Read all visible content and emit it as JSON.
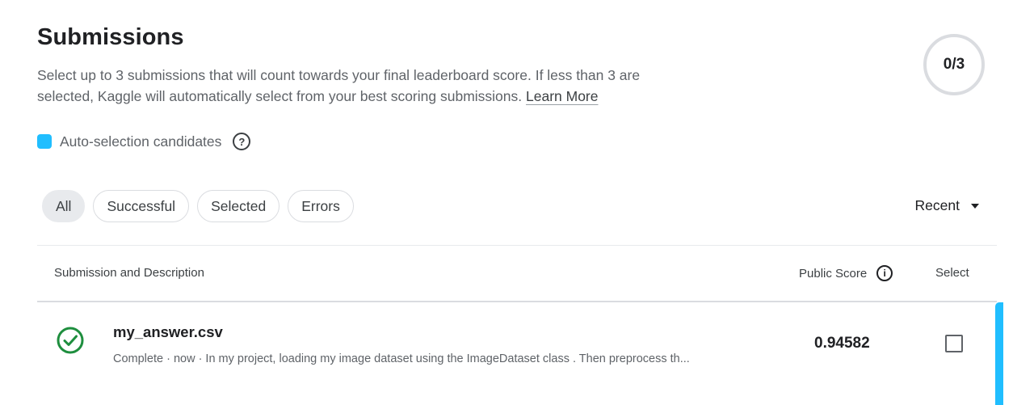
{
  "header": {
    "title": "Submissions",
    "description": "Select up to 3 submissions that will count towards your final leaderboard score. If less than 3 are selected, Kaggle will automatically select from your best scoring submissions.",
    "learn_more": "Learn More",
    "counter": "0/3"
  },
  "legend": {
    "label": "Auto-selection candidates",
    "swatch_color": "#20beff",
    "help_icon": "?"
  },
  "filters": {
    "chips": [
      {
        "label": "All",
        "active": true
      },
      {
        "label": "Successful",
        "active": false
      },
      {
        "label": "Selected",
        "active": false
      },
      {
        "label": "Errors",
        "active": false
      }
    ],
    "sort_label": "Recent"
  },
  "table": {
    "headers": {
      "description": "Submission and Description",
      "score": "Public Score",
      "score_info_icon": "i",
      "select": "Select"
    },
    "rows": [
      {
        "name": "my_answer.csv",
        "meta": "Complete · now · In my project, loading my image dataset using the ImageDataset class . Then preprocess th...",
        "score": "0.94582",
        "status": "success"
      }
    ]
  },
  "colors": {
    "accent": "#20beff",
    "success": "#1e8e3e"
  }
}
